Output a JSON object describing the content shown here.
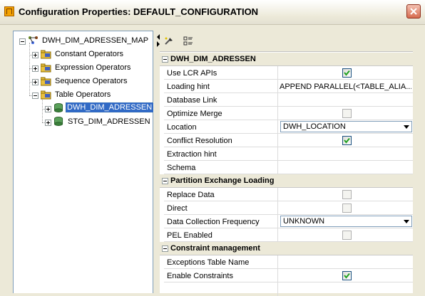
{
  "window": {
    "title": "Configuration Properties: DEFAULT_CONFIGURATION",
    "close_icon": "close-icon"
  },
  "tree": {
    "root": "DWH_DIM_ADRESSEN_MAP",
    "items": [
      {
        "label": "Constant Operators"
      },
      {
        "label": "Expression Operators"
      },
      {
        "label": "Sequence Operators"
      },
      {
        "label": "Table Operators"
      }
    ],
    "children": [
      {
        "label": "DWH_DIM_ADRESSEN",
        "selected": true
      },
      {
        "label": "STG_DIM_ADRESSEN",
        "selected": false
      }
    ]
  },
  "toolbar": {
    "icons": [
      "properties-icon",
      "categorize-icon"
    ]
  },
  "sections": [
    {
      "title": "DWH_DIM_ADRESSEN",
      "rows": [
        {
          "name": "Use LCR APIs",
          "type": "checkbox",
          "checked": true
        },
        {
          "name": "Loading hint",
          "type": "text",
          "value": "APPEND PARALLEL(<TABLE_ALIA..."
        },
        {
          "name": "Database Link",
          "type": "text",
          "value": ""
        },
        {
          "name": "Optimize Merge",
          "type": "checkbox",
          "checked": false
        },
        {
          "name": "Location",
          "type": "combo",
          "value": "DWH_LOCATION"
        },
        {
          "name": "Conflict Resolution",
          "type": "checkbox",
          "checked": true
        },
        {
          "name": "Extraction hint",
          "type": "text",
          "value": ""
        },
        {
          "name": "Schema",
          "type": "text",
          "value": ""
        }
      ]
    },
    {
      "title": "Partition Exchange Loading",
      "rows": [
        {
          "name": "Replace Data",
          "type": "checkbox",
          "checked": false
        },
        {
          "name": "Direct",
          "type": "checkbox",
          "checked": false
        },
        {
          "name": "Data Collection Frequency",
          "type": "combo",
          "value": "UNKNOWN"
        },
        {
          "name": "PEL Enabled",
          "type": "checkbox",
          "checked": false
        }
      ]
    },
    {
      "title": "Constraint management",
      "rows": [
        {
          "name": "Exceptions Table Name",
          "type": "text",
          "value": ""
        },
        {
          "name": "Enable Constraints",
          "type": "checkbox",
          "checked": true
        }
      ]
    }
  ],
  "colors": {
    "selection": "#316ac5",
    "check": "#21a121"
  }
}
